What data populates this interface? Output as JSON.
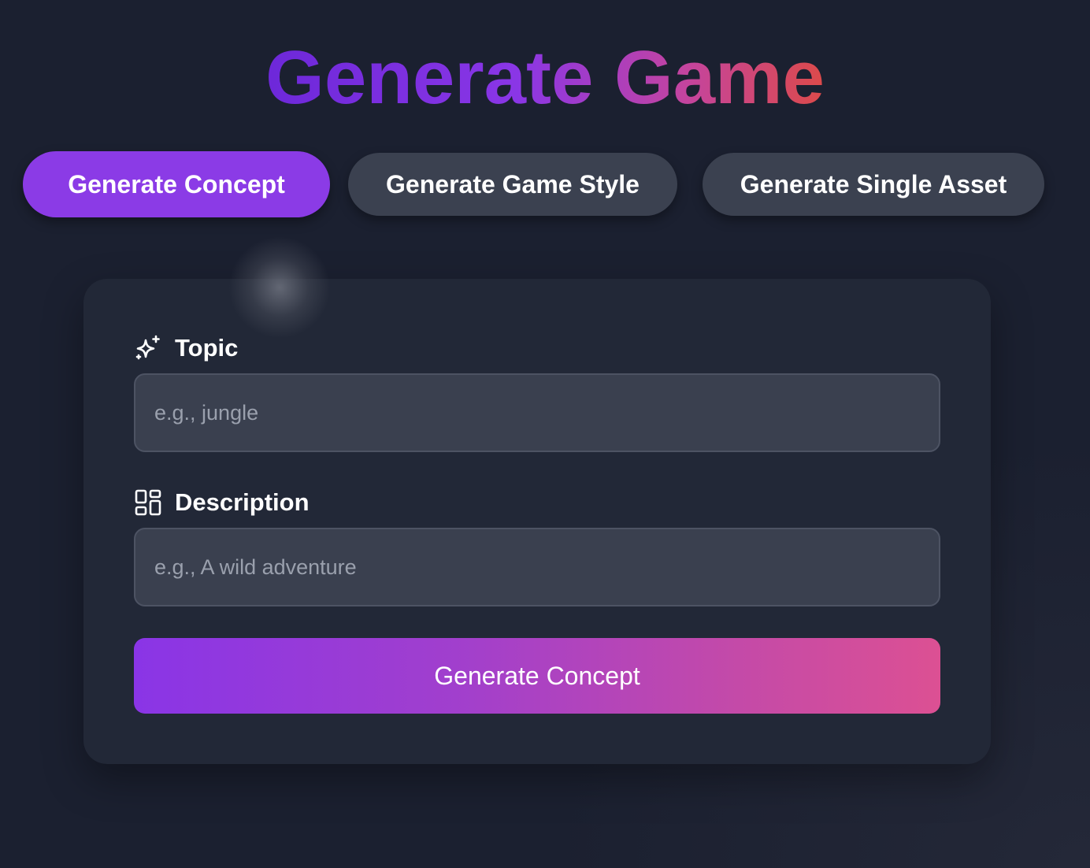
{
  "header": {
    "title": "Generate Game"
  },
  "tabs": [
    {
      "label": "Generate Concept",
      "active": true
    },
    {
      "label": "Generate Game Style",
      "active": false
    },
    {
      "label": "Generate Single Asset",
      "active": false
    }
  ],
  "form": {
    "topic": {
      "label": "Topic",
      "icon": "sparkles-icon",
      "value": "",
      "placeholder": "e.g., jungle"
    },
    "description": {
      "label": "Description",
      "icon": "layout-grid-icon",
      "value": "",
      "placeholder": "e.g., A wild adventure"
    },
    "submit_label": "Generate Concept"
  },
  "colors": {
    "background": "#1b2030",
    "card": "#222837",
    "active_tab": "#8b3be6",
    "inactive_tab": "#3b4150",
    "input_bg": "#3a404f",
    "title_gradient": [
      "#6d28d9",
      "#8a36e6",
      "#c4449f",
      "#dc4a4a"
    ],
    "button_gradient": [
      "#8a35e6",
      "#dc5093"
    ]
  }
}
